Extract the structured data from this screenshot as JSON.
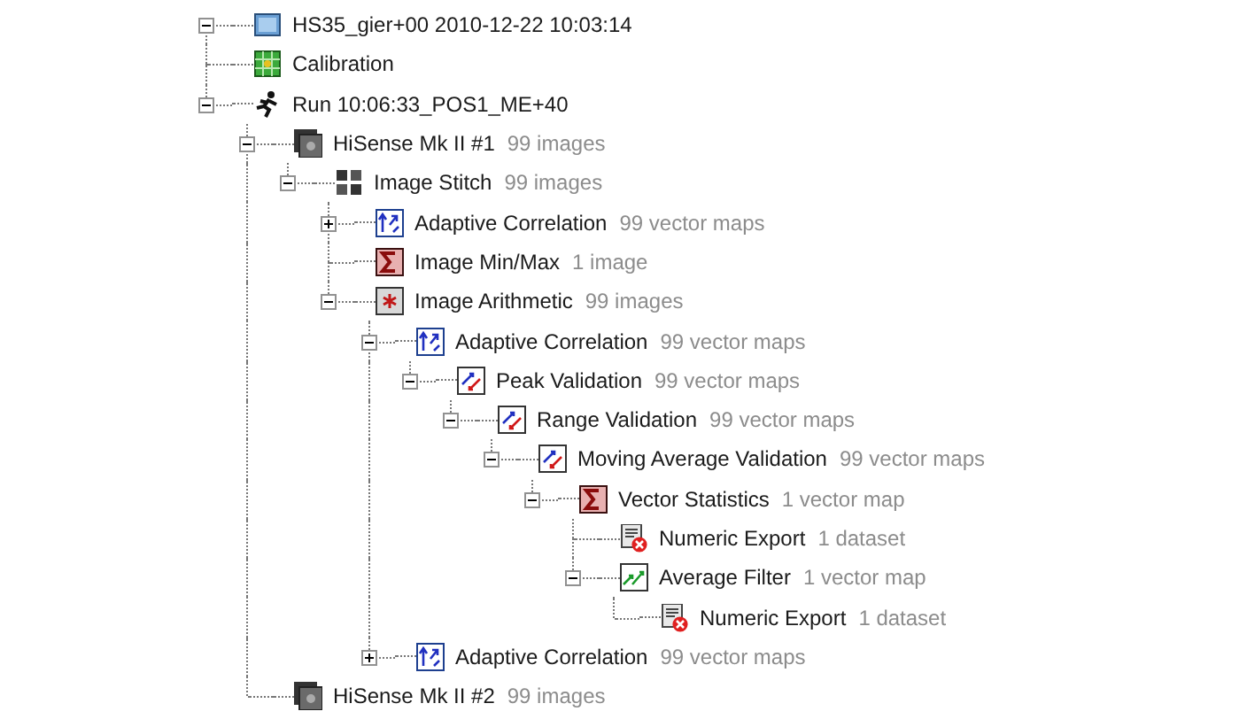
{
  "tree": [
    {
      "kind": "database",
      "name": "HS35_gier+00 2010-12-22 10:03:14",
      "expanded": true,
      "children": [
        {
          "kind": "calibration",
          "name": "Calibration"
        },
        {
          "kind": "run",
          "name": "Run 10:06:33_POS1_ME+40",
          "expanded": true,
          "children": [
            {
              "kind": "camera",
              "name": "HiSense Mk II #1",
              "count": "99 images",
              "expanded": true,
              "children": [
                {
                  "kind": "stitch",
                  "name": "Image Stitch",
                  "count": "99 images",
                  "expanded": true,
                  "children": [
                    {
                      "kind": "correlation",
                      "name": "Adaptive Correlation",
                      "count": "99 vector maps",
                      "expanded": false
                    },
                    {
                      "kind": "statistics",
                      "name": "Image Min/Max",
                      "count": "1 image"
                    },
                    {
                      "kind": "arithmetic",
                      "name": "Image Arithmetic",
                      "count": "99 images",
                      "expanded": true,
                      "children": [
                        {
                          "kind": "correlation",
                          "name": "Adaptive Correlation",
                          "count": "99 vector maps",
                          "expanded": true,
                          "children": [
                            {
                              "kind": "validation",
                              "name": "Peak Validation",
                              "count": "99 vector maps",
                              "expanded": true,
                              "children": [
                                {
                                  "kind": "validation",
                                  "name": "Range Validation",
                                  "count": "99 vector maps",
                                  "expanded": true,
                                  "children": [
                                    {
                                      "kind": "validation",
                                      "name": "Moving Average Validation",
                                      "count": "99 vector maps",
                                      "expanded": true,
                                      "children": [
                                        {
                                          "kind": "statistics",
                                          "name": "Vector Statistics",
                                          "count": "1 vector map",
                                          "expanded": true,
                                          "children": [
                                            {
                                              "kind": "export",
                                              "name": "Numeric Export",
                                              "count": "1 dataset"
                                            },
                                            {
                                              "kind": "filter",
                                              "name": "Average Filter",
                                              "count": "1 vector map",
                                              "expanded": true,
                                              "children": [
                                                {
                                                  "kind": "export",
                                                  "name": "Numeric Export",
                                                  "count": "1 dataset"
                                                }
                                              ]
                                            }
                                          ]
                                        }
                                      ]
                                    }
                                  ]
                                }
                              ]
                            }
                          ]
                        },
                        {
                          "kind": "correlation",
                          "name": "Adaptive Correlation",
                          "count": "99 vector maps",
                          "expanded": false
                        }
                      ]
                    }
                  ]
                }
              ]
            },
            {
              "kind": "camera",
              "name": "HiSense Mk II #2",
              "count": "99 images"
            }
          ]
        }
      ]
    }
  ]
}
